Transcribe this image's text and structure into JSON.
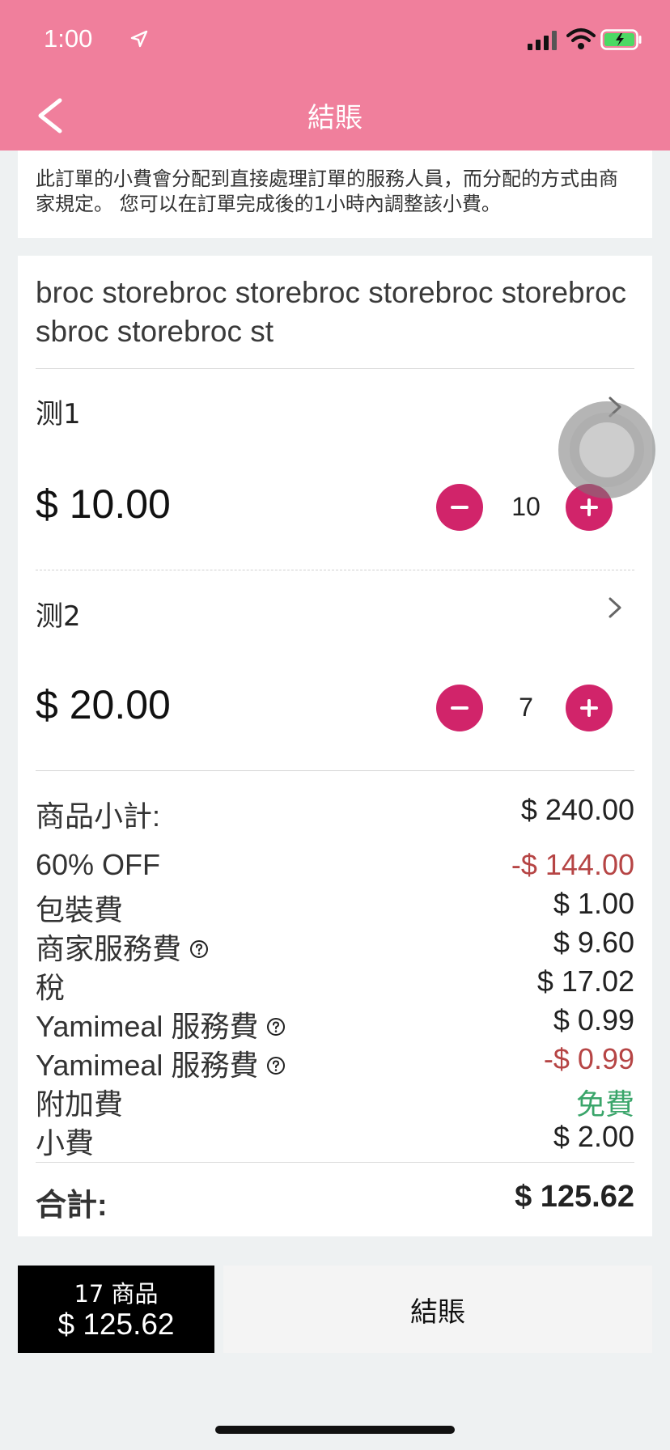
{
  "status_bar": {
    "time": "1:00"
  },
  "header": {
    "title": "結賬"
  },
  "notice": "此訂單的小費會分配到直接處理訂單的服務人員，而分配的方式由商家規定。 您可以在訂單完成後的1小時內調整該小費。",
  "store": {
    "name": "broc storebroc storebroc storebroc storebroc sbroc storebroc st"
  },
  "items": [
    {
      "name": "测1",
      "price": "$ 10.00",
      "quantity": "10"
    },
    {
      "name": "测2",
      "price": "$ 20.00",
      "quantity": "7"
    }
  ],
  "summary": {
    "subtotal_label": "商品小計:",
    "subtotal_value": "$ 240.00",
    "rows": [
      {
        "label": "60% OFF",
        "value": "-$ 144.00"
      },
      {
        "label": "包裝費",
        "value": "$ 1.00"
      },
      {
        "label": "商家服務費",
        "value": "$ 9.60"
      },
      {
        "label": "稅",
        "value": "$ 17.02"
      },
      {
        "label": "Yamimeal 服務費",
        "value": "$ 0.99"
      },
      {
        "label": "Yamimeal 服務費",
        "value": "-$ 0.99"
      },
      {
        "label": "附加費",
        "value": "免費"
      },
      {
        "label": "小費",
        "value": "$ 2.00"
      }
    ],
    "total_label": "合計:",
    "total_value": "$ 125.62"
  },
  "bottom_bar": {
    "item_count": "17 商品",
    "total": "$ 125.62",
    "checkout_label": "結賬"
  },
  "colors": {
    "header": "#f07f9c",
    "accent": "#d1246a",
    "negative": "#b64545",
    "free": "#3aa56a"
  }
}
